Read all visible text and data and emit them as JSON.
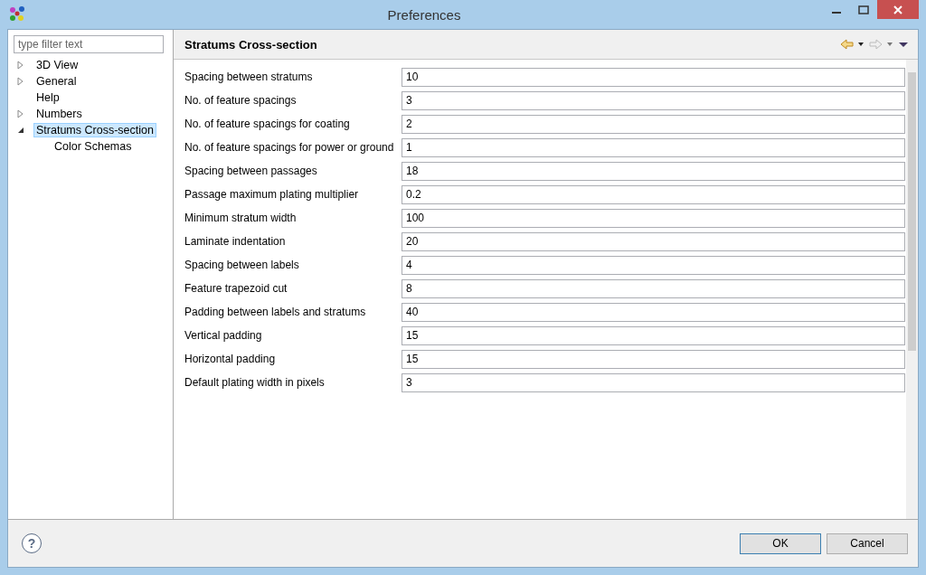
{
  "window": {
    "title": "Preferences"
  },
  "filter": {
    "placeholder": "type filter text"
  },
  "tree": [
    {
      "label": "3D View",
      "expanded": false,
      "selected": false
    },
    {
      "label": "General",
      "expanded": false,
      "selected": false
    },
    {
      "label": "Help",
      "selected": false
    },
    {
      "label": "Numbers",
      "expanded": false,
      "selected": false
    },
    {
      "label": "Stratums Cross-section",
      "expanded": true,
      "selected": true,
      "children": [
        {
          "label": "Color Schemas",
          "selected": false
        }
      ]
    }
  ],
  "page": {
    "title": "Stratums Cross-section"
  },
  "fields": [
    {
      "label": "Spacing between stratums",
      "value": "10"
    },
    {
      "label": "No. of feature spacings",
      "value": "3"
    },
    {
      "label": "No. of feature spacings for coating",
      "value": "2"
    },
    {
      "label": "No. of feature spacings for power or ground",
      "value": "1"
    },
    {
      "label": "Spacing between passages",
      "value": "18"
    },
    {
      "label": "Passage maximum plating multiplier",
      "value": "0.2"
    },
    {
      "label": "Minimum stratum width",
      "value": "100"
    },
    {
      "label": "Laminate indentation",
      "value": "20"
    },
    {
      "label": "Spacing between labels",
      "value": "4"
    },
    {
      "label": "Feature trapezoid cut",
      "value": "8"
    },
    {
      "label": "Padding between labels and stratums",
      "value": "40"
    },
    {
      "label": "Vertical padding",
      "value": "15"
    },
    {
      "label": "Horizontal padding",
      "value": "15"
    },
    {
      "label": "Default plating width in pixels",
      "value": "3"
    }
  ],
  "help": {
    "label": "?"
  },
  "buttons": [
    {
      "label": "OK",
      "default": true
    },
    {
      "label": "Cancel",
      "default": false
    }
  ]
}
